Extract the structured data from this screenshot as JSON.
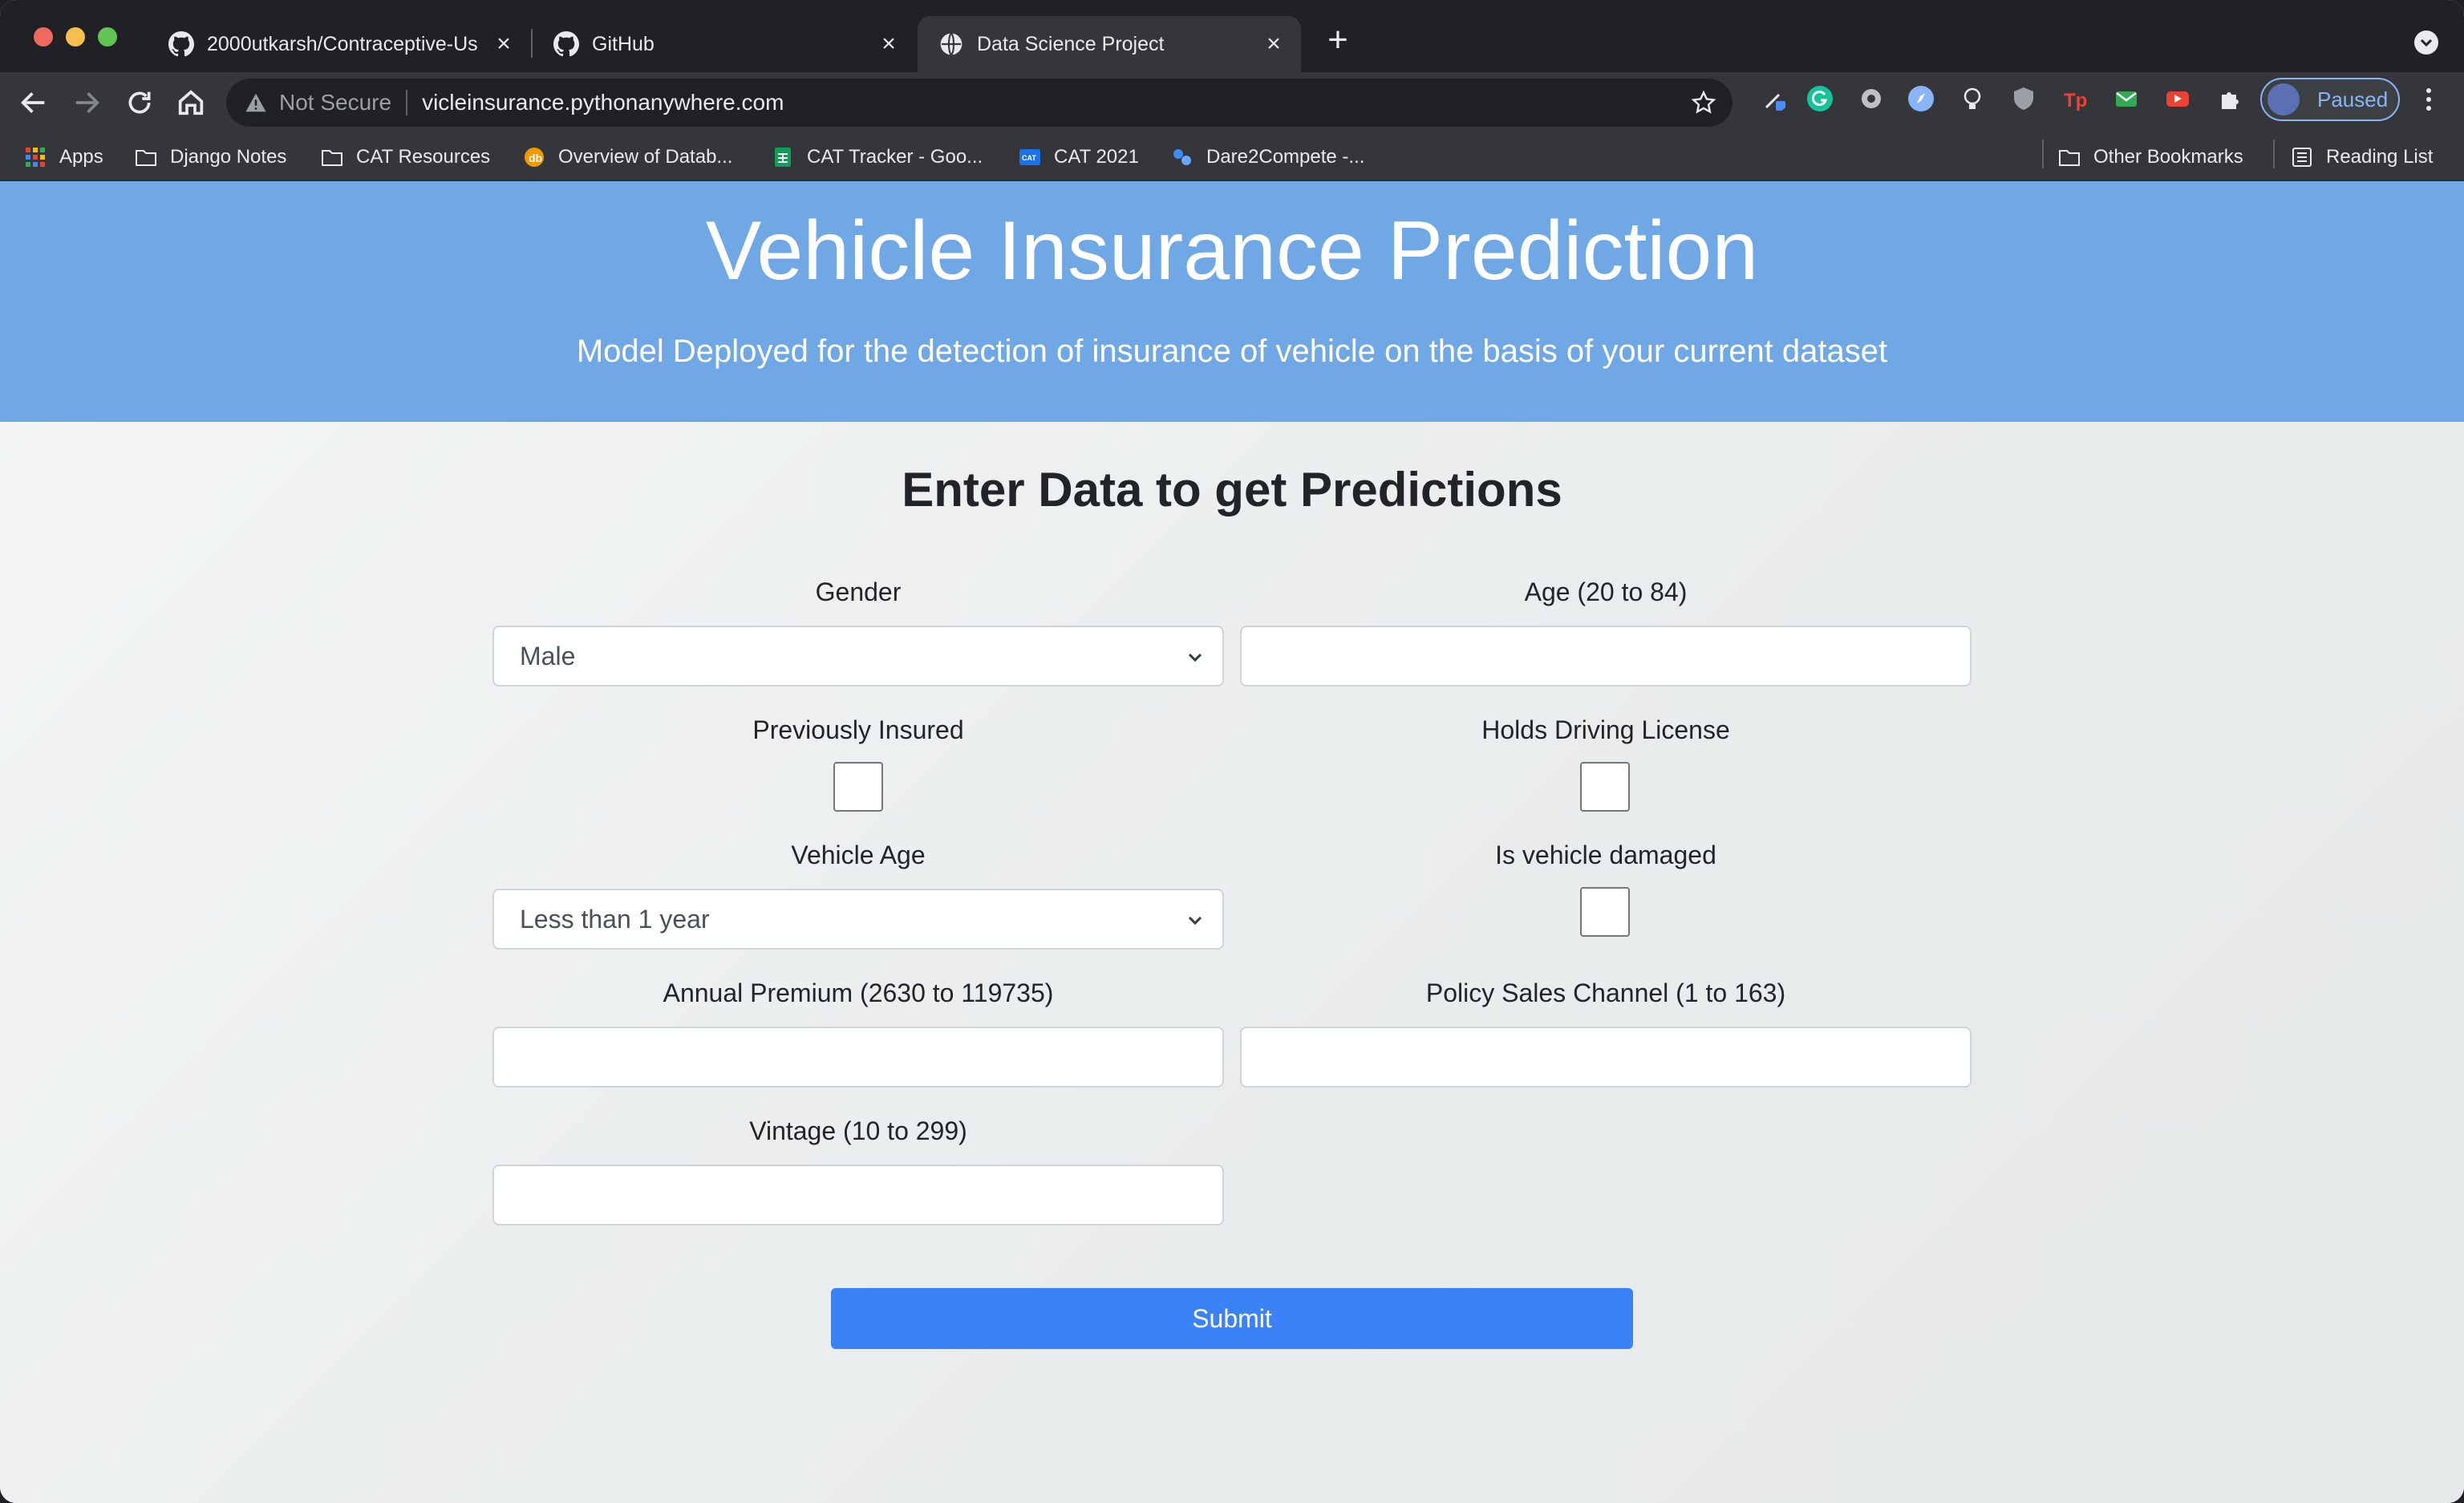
{
  "browser": {
    "tabs": [
      {
        "label": "2000utkarsh/Contraceptive-Us",
        "icon": "github-icon",
        "active": false
      },
      {
        "label": "GitHub",
        "icon": "github-icon",
        "active": false
      },
      {
        "label": "Data Science Project",
        "icon": "globe-icon",
        "active": true
      }
    ],
    "address_bar": {
      "security_label": "Not Secure",
      "url": "vicleinsurance.pythonanywhere.com"
    },
    "profile_label": "Paused",
    "bookmarks": [
      {
        "label": "Apps",
        "icon": "apps-grid-icon"
      },
      {
        "label": "Django Notes",
        "icon": "folder-icon"
      },
      {
        "label": "CAT Resources",
        "icon": "folder-icon"
      },
      {
        "label": "Overview of Datab...",
        "icon": "site-favicon-icon"
      },
      {
        "label": "CAT Tracker - Goo...",
        "icon": "sheets-icon"
      },
      {
        "label": "CAT 2021",
        "icon": "cat-favicon-icon"
      },
      {
        "label": "Dare2Compete -...",
        "icon": "d2c-favicon-icon"
      }
    ],
    "bookmarks_right": [
      {
        "label": "Other Bookmarks",
        "icon": "folder-icon"
      },
      {
        "label": "Reading List",
        "icon": "reading-list-icon"
      }
    ]
  },
  "page": {
    "title": "Vehicle Insurance Prediction",
    "subtitle": "Model Deployed for the detection of insurance of vehicle on the basis of your current dataset",
    "form_title": "Enter Data to get Predictions",
    "fields": {
      "gender": {
        "label": "Gender",
        "value": "Male"
      },
      "age": {
        "label": "Age (20 to 84)",
        "value": ""
      },
      "previously_insured": {
        "label": "Previously Insured",
        "checked": false
      },
      "driving_license": {
        "label": "Holds Driving License",
        "checked": false
      },
      "vehicle_age": {
        "label": "Vehicle Age",
        "value": "Less than 1 year"
      },
      "vehicle_damaged": {
        "label": "Is vehicle damaged",
        "checked": false
      },
      "annual_premium": {
        "label": "Annual Premium (2630 to 119735)",
        "value": ""
      },
      "policy_channel": {
        "label": "Policy Sales Channel (1 to 163)",
        "value": ""
      },
      "vintage": {
        "label": "Vintage (10 to 299)",
        "value": ""
      }
    },
    "submit_label": "Submit"
  },
  "colors": {
    "hero_bg": "#6fa8e4",
    "submit_bg": "#3b82f6",
    "browser_frame": "#202124",
    "toolbar": "#35363a"
  }
}
